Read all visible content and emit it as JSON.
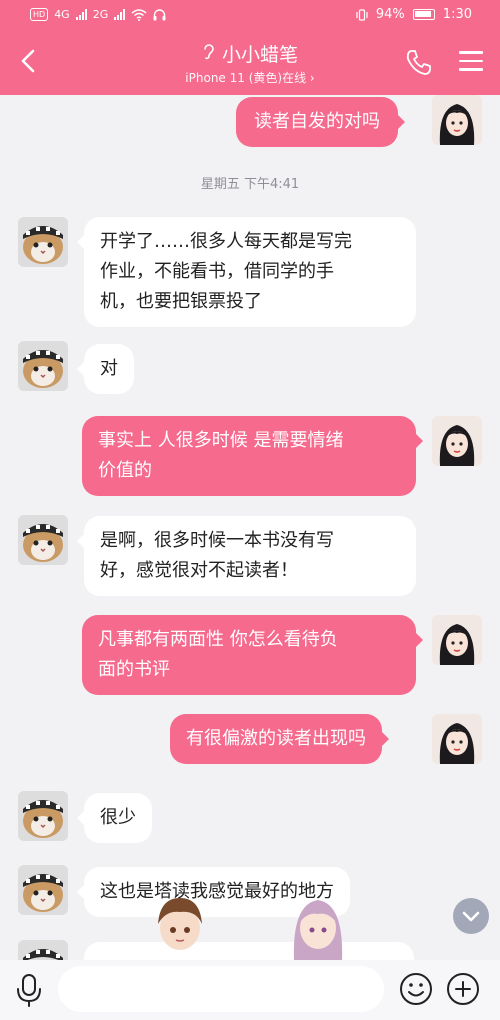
{
  "status_bar": {
    "left_badge": "HD",
    "network_1": "4G",
    "network_2": "2G",
    "battery": "94%",
    "time": "1:30"
  },
  "header": {
    "title": "小小蜡笔",
    "subtitle": "iPhone 11 (黄色)在线 ›",
    "background": "#f56a8d"
  },
  "timestamp": "星期五 下午4:41",
  "messages": [
    {
      "side": "out",
      "text": "读者自发的对吗"
    },
    {
      "side": "in",
      "lines": [
        "开学了……很多人每天都是写完",
        "作业，不能看书，借同学的手",
        "机，也要把银票投了"
      ]
    },
    {
      "side": "in",
      "text": "对"
    },
    {
      "side": "out",
      "lines": [
        "事实上  人很多时候 是需要情绪",
        "价值的"
      ]
    },
    {
      "side": "in",
      "lines": [
        "是啊，很多时候一本书没有写",
        "好，感觉很对不起读者！"
      ]
    },
    {
      "side": "out",
      "lines": [
        "凡事都有两面性 你怎么看待负",
        "面的书评"
      ]
    },
    {
      "side": "out",
      "text": "有很偏激的读者出现吗"
    },
    {
      "side": "in",
      "text": "很少"
    },
    {
      "side": "in",
      "text": "这也是塔读我感觉最好的地方"
    }
  ],
  "colors": {
    "accent": "#f56a8d",
    "incoming_bubble": "#ffffff",
    "chat_background": "#f2f2f4"
  },
  "icons": {
    "back": "chevron-left-icon",
    "phone": "phone-icon",
    "menu": "menu-icon",
    "mic": "microphone-icon",
    "emoji": "smile-icon",
    "plus": "plus-icon",
    "scroll": "chevron-down-icon"
  },
  "input": {
    "value": "",
    "placeholder": ""
  }
}
